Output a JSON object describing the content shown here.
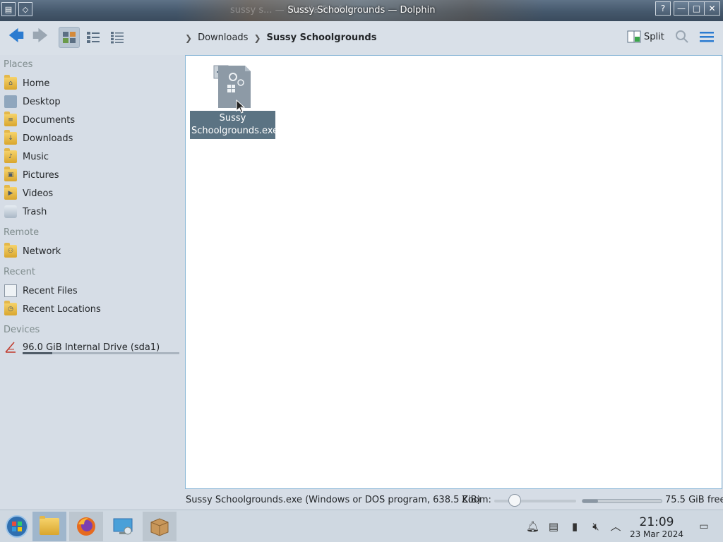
{
  "window": {
    "title": "Sussy Schoolgrounds — Dolphin",
    "ghost_title": "sussy s... — Mozilla Firefox",
    "buttons": {
      "help": "?",
      "minimize": "—",
      "maximize": "□",
      "close": "✕"
    }
  },
  "toolbar": {
    "breadcrumb": [
      "Downloads",
      "Sussy Schoolgrounds"
    ],
    "split_label": "Split"
  },
  "sidebar": {
    "sections": {
      "places": "Places",
      "remote": "Remote",
      "recent": "Recent",
      "devices": "Devices"
    },
    "places": [
      {
        "label": "Home",
        "icon": "home-folder-icon"
      },
      {
        "label": "Desktop",
        "icon": "desktop-folder-icon"
      },
      {
        "label": "Documents",
        "icon": "documents-folder-icon"
      },
      {
        "label": "Downloads",
        "icon": "downloads-folder-icon"
      },
      {
        "label": "Music",
        "icon": "music-folder-icon"
      },
      {
        "label": "Pictures",
        "icon": "pictures-folder-icon"
      },
      {
        "label": "Videos",
        "icon": "videos-folder-icon"
      },
      {
        "label": "Trash",
        "icon": "trash-icon"
      }
    ],
    "remote": [
      {
        "label": "Network",
        "icon": "network-folder-icon"
      }
    ],
    "recent": [
      {
        "label": "Recent Files",
        "icon": "recent-files-icon"
      },
      {
        "label": "Recent Locations",
        "icon": "recent-locations-icon"
      }
    ],
    "devices": [
      {
        "label": "96.0 GiB Internal Drive (sda1)",
        "icon": "drive-icon",
        "usage_fraction": 0.19
      }
    ]
  },
  "files": [
    {
      "name": "Sussy Schoolgrounds.exe",
      "name_line1": "Sussy",
      "name_line2": "Schoolgrounds.exe",
      "selected": true,
      "icon": "executable-icon"
    }
  ],
  "statusbar": {
    "file_info": "Sussy Schoolgrounds.exe (Windows or DOS program, 638.5 KiB)",
    "zoom_label": "Zoom:",
    "zoom_fraction": 0.25,
    "free_space": "75.5 GiB free",
    "used_fraction": 0.2
  },
  "taskbar": {
    "apps": [
      "start-menu-icon",
      "dolphin-icon",
      "firefox-icon",
      "system-settings-icon",
      "package-icon"
    ],
    "tray": [
      "notifications-icon",
      "clipboard-icon",
      "battery-icon",
      "volume-muted-icon",
      "show-hidden-icon"
    ],
    "clock_time": "21:09",
    "clock_date": "23 Mar 2024"
  },
  "colors": {
    "accent": "#2b7bd0",
    "selection": "#5b7383",
    "sidebar_bg": "#d6dde6",
    "titlebar": "#45586c"
  }
}
